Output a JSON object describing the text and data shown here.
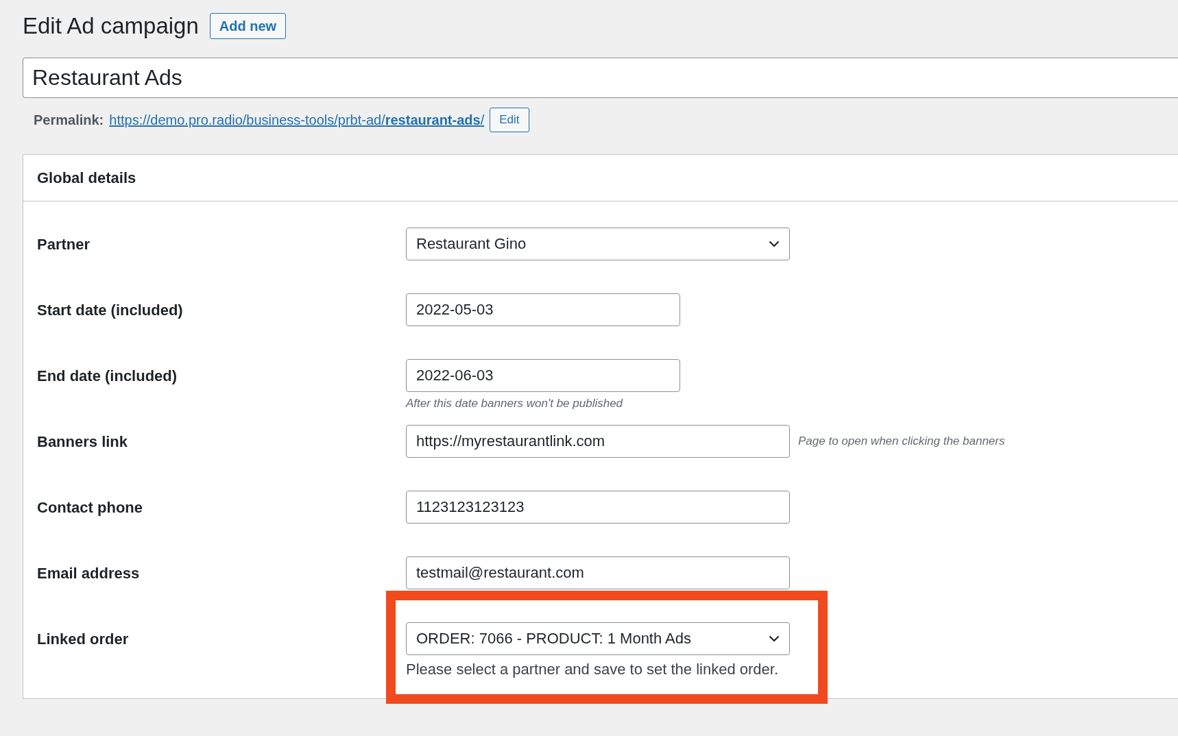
{
  "page": {
    "title": "Edit Ad campaign",
    "add_new_button": "Add new"
  },
  "post_title": {
    "value": "Restaurant Ads"
  },
  "permalink": {
    "label": "Permalink:",
    "url": "https://demo.pro.radio/business-tools/prbt-ad/**restaurant-ads**/",
    "edit_button": "Edit"
  },
  "panel": {
    "title": "Global details",
    "fields": [
      {
        "kind": "select",
        "label": "Partner",
        "value": "Restaurant Gino",
        "highlighted": false
      },
      {
        "kind": "date",
        "label": "Start date (included)",
        "value": "2022-05-03",
        "highlighted": false
      },
      {
        "kind": "date",
        "label": "End date (included)",
        "value": "2022-06-03",
        "highlighted": false,
        "hint_below": "After this date banners won't be published"
      },
      {
        "kind": "text",
        "label": "Banners link",
        "value": "https://myrestaurantlink.com",
        "highlighted": false,
        "hint_beside": "Page to open when clicking the banners"
      },
      {
        "kind": "text",
        "label": "Contact phone",
        "value": "1123123123123",
        "highlighted": false
      },
      {
        "kind": "text",
        "label": "Email address",
        "value": "testmail@restaurant.com",
        "highlighted": false
      },
      {
        "kind": "select",
        "label": "Linked order",
        "value": "ORDER: 7066 - PRODUCT: 1 Month Ads",
        "highlighted": true,
        "help_text": "Please select a partner and save to set the linked order."
      }
    ]
  }
}
